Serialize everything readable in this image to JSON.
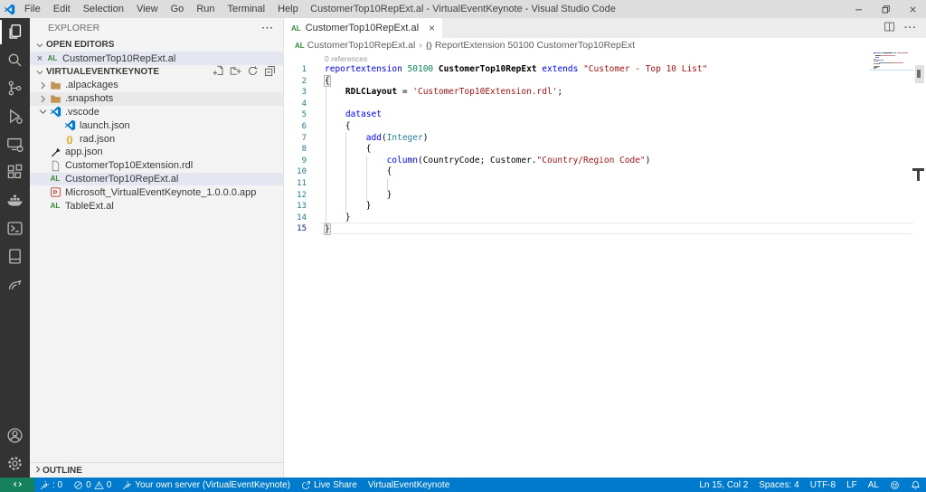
{
  "window": {
    "title": "CustomerTop10RepExt.al - VirtualEventKeynote - Visual Studio Code",
    "controls": [
      "minimize",
      "restore",
      "close"
    ]
  },
  "menu": [
    "File",
    "Edit",
    "Selection",
    "View",
    "Go",
    "Run",
    "Terminal",
    "Help"
  ],
  "activity_bar": {
    "top": [
      {
        "name": "explorer",
        "icon": "files",
        "active": true
      },
      {
        "name": "search",
        "icon": "search",
        "active": false
      },
      {
        "name": "source-control",
        "icon": "scm",
        "active": false
      },
      {
        "name": "run-debug",
        "icon": "debug",
        "active": false
      },
      {
        "name": "remote-explorer",
        "icon": "remote",
        "active": false
      },
      {
        "name": "extensions",
        "icon": "extensions",
        "active": false
      },
      {
        "name": "docker",
        "icon": "docker",
        "active": false
      },
      {
        "name": "powershell",
        "icon": "powershell",
        "active": false
      },
      {
        "name": "book",
        "icon": "book",
        "active": false
      },
      {
        "name": "signal",
        "icon": "signal",
        "active": false
      }
    ],
    "bottom": [
      {
        "name": "accounts",
        "icon": "account",
        "active": false
      },
      {
        "name": "settings",
        "icon": "gear",
        "active": false
      }
    ]
  },
  "sidebar": {
    "title": "EXPLORER",
    "title_more": "···",
    "open_editors": {
      "label": "OPEN EDITORS",
      "items": [
        {
          "label": "CustomerTop10RepExt.al",
          "icon": "al",
          "close": "×",
          "selected": true
        }
      ]
    },
    "workspace": {
      "label": "VIRTUALEVENTKEYNOTE",
      "actions": [
        "new-file",
        "new-folder",
        "refresh",
        "collapse-all"
      ]
    },
    "tree": [
      {
        "label": ".alpackages",
        "icon": "folder",
        "chevron": "right",
        "indent": 0
      },
      {
        "label": ".snapshots",
        "icon": "folder",
        "chevron": "right",
        "indent": 0,
        "hover": true
      },
      {
        "label": ".vscode",
        "icon": "vscode",
        "chevron": "down",
        "indent": 0
      },
      {
        "label": "launch.json",
        "icon": "vscode",
        "indent": 1
      },
      {
        "label": "rad.json",
        "icon": "json",
        "indent": 1
      },
      {
        "label": "app.json",
        "icon": "tool",
        "indent": 0
      },
      {
        "label": "CustomerTop10Extension.rdl",
        "icon": "file",
        "indent": 0
      },
      {
        "label": "CustomerTop10RepExt.al",
        "icon": "al",
        "indent": 0,
        "selected": true
      },
      {
        "label": "Microsoft_VirtualEventKeynote_1.0.0.0.app",
        "icon": "app",
        "indent": 0
      },
      {
        "label": "TableExt.al",
        "icon": "al",
        "indent": 0
      }
    ],
    "outline_label": "OUTLINE"
  },
  "editor": {
    "tab": {
      "icon": "AL",
      "title": "CustomerTop10RepExt.al",
      "close": "×"
    },
    "tab_actions": [
      "split-editor",
      "more"
    ],
    "breadcrumb": [
      {
        "icon": "AL",
        "label": "CustomerTop10RepExt.al"
      },
      {
        "sym": "{}",
        "label": "ReportExtension 50100 CustomerTop10RepExt"
      }
    ],
    "codelens": "0 references",
    "cursor": {
      "line": 15,
      "col": 2
    },
    "lines": [
      {
        "n": 1,
        "seg": [
          [
            "kw",
            "reportextension"
          ],
          [
            "pl",
            " "
          ],
          [
            "num",
            "50100"
          ],
          [
            "pl",
            " "
          ],
          [
            "id",
            "CustomerTop10RepExt"
          ],
          [
            "pl",
            " "
          ],
          [
            "kw",
            "extends"
          ],
          [
            "pl",
            " "
          ],
          [
            "str",
            "\"Customer - Top 10 List\""
          ]
        ]
      },
      {
        "n": 2,
        "seg": [
          [
            "brk",
            "{"
          ]
        ]
      },
      {
        "n": 3,
        "seg": [
          [
            "pl",
            "    "
          ],
          [
            "id",
            "RDLCLayout"
          ],
          [
            "pl",
            " = "
          ],
          [
            "str",
            "'CustomerTop10Extension.rdl'"
          ],
          [
            "pl",
            ";"
          ]
        ]
      },
      {
        "n": 4,
        "seg": []
      },
      {
        "n": 5,
        "seg": [
          [
            "pl",
            "    "
          ],
          [
            "kw",
            "dataset"
          ]
        ]
      },
      {
        "n": 6,
        "seg": [
          [
            "pl",
            "    {"
          ]
        ]
      },
      {
        "n": 7,
        "seg": [
          [
            "pl",
            "        "
          ],
          [
            "kw",
            "add"
          ],
          [
            "pl",
            "("
          ],
          [
            "type",
            "Integer"
          ],
          [
            "pl",
            ")"
          ]
        ]
      },
      {
        "n": 8,
        "seg": [
          [
            "pl",
            "        {"
          ]
        ]
      },
      {
        "n": 9,
        "seg": [
          [
            "pl",
            "            "
          ],
          [
            "kw",
            "column"
          ],
          [
            "pl",
            "(CountryCode; Customer."
          ],
          [
            "str",
            "\"Country/Region Code\""
          ],
          [
            "pl",
            ")"
          ]
        ]
      },
      {
        "n": 10,
        "seg": [
          [
            "pl",
            "            {"
          ]
        ]
      },
      {
        "n": 11,
        "seg": []
      },
      {
        "n": 12,
        "seg": [
          [
            "pl",
            "            }"
          ]
        ]
      },
      {
        "n": 13,
        "seg": [
          [
            "pl",
            "        }"
          ]
        ]
      },
      {
        "n": 14,
        "seg": [
          [
            "pl",
            "    }"
          ]
        ]
      },
      {
        "n": 15,
        "seg": [
          [
            "brk",
            "}"
          ]
        ],
        "current": true
      }
    ]
  },
  "status_bar": {
    "left": [
      {
        "name": "remote-indicator",
        "remote": true,
        "parts": [
          {
            "icon": "remote-sym"
          }
        ]
      },
      {
        "name": "al-rad-status",
        "parts": [
          {
            "icon": "plug"
          },
          {
            "text": ": 0"
          }
        ]
      },
      {
        "name": "problems-status",
        "parts": [
          {
            "icon": "error-circle"
          },
          {
            "text": "0"
          },
          {
            "icon": "warning-triangle"
          },
          {
            "text": "0"
          }
        ]
      },
      {
        "name": "al-server-status",
        "parts": [
          {
            "icon": "plug"
          },
          {
            "text": "Your own server (VirtualEventKeynote)"
          }
        ]
      },
      {
        "name": "live-share-status",
        "parts": [
          {
            "icon": "live-share"
          },
          {
            "text": "Live Share"
          }
        ]
      },
      {
        "name": "workspace-status",
        "parts": [
          {
            "text": "VirtualEventKeynote"
          }
        ]
      }
    ],
    "right": [
      {
        "name": "cursor-position",
        "parts": [
          {
            "text": "Ln 15, Col 2"
          }
        ]
      },
      {
        "name": "indentation",
        "parts": [
          {
            "text": "Spaces: 4"
          }
        ]
      },
      {
        "name": "encoding",
        "parts": [
          {
            "text": "UTF-8"
          }
        ]
      },
      {
        "name": "eol",
        "parts": [
          {
            "text": "LF"
          }
        ]
      },
      {
        "name": "language-mode",
        "parts": [
          {
            "text": "AL"
          }
        ]
      },
      {
        "name": "feedback",
        "parts": [
          {
            "icon": "smiley"
          }
        ]
      },
      {
        "name": "notifications",
        "parts": [
          {
            "icon": "bell"
          }
        ]
      }
    ]
  },
  "colors": {
    "accent": "#007ACC",
    "remote_green": "#16825D",
    "keyword": "#0000FF",
    "number": "#098658",
    "string": "#A31515",
    "type": "#267F99",
    "al_green": "#388A34",
    "json_orange": "#D19A00",
    "folder_tan": "#C09553"
  }
}
